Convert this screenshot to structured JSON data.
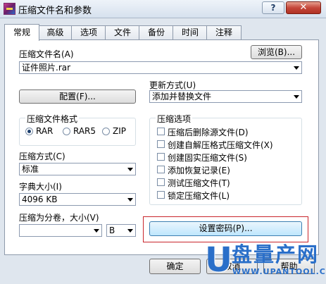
{
  "window": {
    "title": "压缩文件名和参数",
    "help_label": "?",
    "close_label": "✕"
  },
  "tabs": [
    "常规",
    "高级",
    "选项",
    "文件",
    "备份",
    "时间",
    "注释"
  ],
  "archive_name": {
    "label": "压缩文件名(A)",
    "value": "证件照片.rar",
    "browse_label": "浏览(B)..."
  },
  "update_mode": {
    "label": "更新方式(U)",
    "value": "添加并替换文件"
  },
  "profiles_button": "配置(F)...",
  "archive_format": {
    "label": "压缩文件格式",
    "options": [
      "RAR",
      "RAR5",
      "ZIP"
    ],
    "selected": "RAR"
  },
  "compression_method": {
    "label": "压缩方式(C)",
    "value": "标准"
  },
  "dictionary_size": {
    "label": "字典大小(I)",
    "value": "4096 KB"
  },
  "split_volumes": {
    "label": "压缩为分卷，大小(V)",
    "value": "",
    "unit": "B"
  },
  "archiving_options": {
    "label": "压缩选项",
    "items": [
      "压缩后删除源文件(D)",
      "创建自解压格式压缩文件(X)",
      "创建固实压缩文件(S)",
      "添加恢复记录(E)",
      "测试压缩文件(T)",
      "锁定压缩文件(L)"
    ]
  },
  "set_password_button": "设置密码(P)...",
  "footer": {
    "ok": "确定",
    "cancel": "取消",
    "help": "帮助"
  },
  "watermark": {
    "letter": "U",
    "text": "盘量产网",
    "url": "WWW.UPANTOOL.COM"
  },
  "colors": {
    "highlight": "#c9252b",
    "watermark": "#2a6fc9"
  }
}
